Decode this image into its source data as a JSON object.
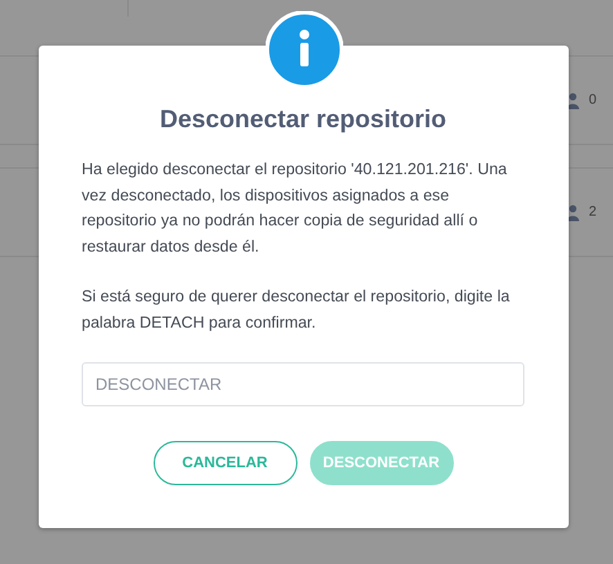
{
  "background_rows": [
    {
      "count": "0"
    },
    {
      "count": "2"
    }
  ],
  "dialog": {
    "title": "Desconectar repositorio",
    "paragraphs": [
      "Ha elegido desconectar el repositorio '40.121.201.216'. Una vez desconectado, los dispositivos asignados a ese repositorio ya no podrán hacer copia de seguridad allí o restaurar datos desde él.",
      "Si está seguro de querer desconectar el repositorio, digite la palabra DETACH para confirmar."
    ],
    "input": {
      "placeholder": "DESCONECTAR"
    },
    "buttons": [
      {
        "label": "CANCELAR",
        "kind": "outline",
        "disabled": false
      },
      {
        "label": "DESCONECTAR",
        "kind": "primary",
        "disabled": true
      }
    ]
  }
}
